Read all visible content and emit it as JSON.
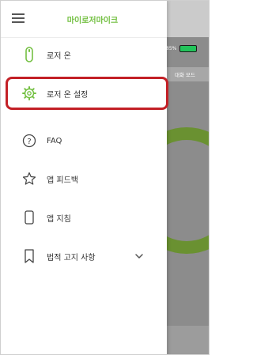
{
  "app": {
    "title": "마이로저마이크"
  },
  "menu": [
    {
      "label": "로저 온"
    },
    {
      "label": "로저 온 설정"
    },
    {
      "label": "FAQ"
    },
    {
      "label": "앱 피드백"
    },
    {
      "label": "앱 지침"
    },
    {
      "label": "법적 고지 사항"
    }
  ],
  "background": {
    "battery_text": "85%",
    "mode_text": "대화 모드"
  },
  "colors": {
    "accent": "#74c043",
    "highlight": "#c32026"
  }
}
